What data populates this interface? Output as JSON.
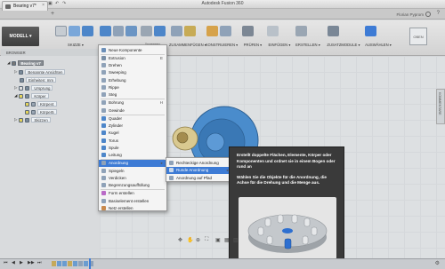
{
  "window": {
    "app_title": "Autodesk Fusion 360",
    "user": "Florian Pyprom"
  },
  "doc_tab": {
    "label": "Bearing v7*"
  },
  "toolbar": {
    "workspace": "MODELL ▾",
    "groups": [
      {
        "label": "SKIZZE ▾",
        "active": false
      },
      {
        "label": "ERSTELLEN ▾",
        "active": true
      },
      {
        "label": "ÄNDERN ▾",
        "active": false
      },
      {
        "label": "ZUSAMMENFÜGEN ▾",
        "active": false
      },
      {
        "label": "KONSTRUIEREN ▾",
        "active": false
      },
      {
        "label": "PRÜFEN ▾",
        "active": false
      },
      {
        "label": "EINFÜGEN ▾",
        "active": false
      },
      {
        "label": "ERSTELLEN ▾",
        "active": false
      },
      {
        "label": "ZUSATZMODULE ▾",
        "active": false
      },
      {
        "label": "AUSWÄHLEN ▾",
        "active": false
      }
    ]
  },
  "browser": {
    "header": "BROWSER",
    "nodes": [
      {
        "label": "Bearing v7",
        "level": 0,
        "sel": true
      },
      {
        "label": "Benannte Ansichten",
        "level": 1
      },
      {
        "label": "Einheiten: mm",
        "level": 1
      },
      {
        "label": "Ursprung",
        "level": 1
      },
      {
        "label": "Körper",
        "level": 1
      },
      {
        "label": "Körper4",
        "level": 2
      },
      {
        "label": "Körper5",
        "level": 2
      },
      {
        "label": "Skizzen",
        "level": 1
      }
    ]
  },
  "menu": {
    "items": [
      {
        "label": "Neue Komponente",
        "shortcut": "",
        "color": "#6c8fb8"
      },
      {
        "label": "Extrusion",
        "shortcut": "E",
        "color": "#7a8fa6"
      },
      {
        "label": "Drehen",
        "shortcut": "",
        "color": "#8fa2b8"
      },
      {
        "label": "Sweeping",
        "shortcut": "",
        "color": "#8fa2b8"
      },
      {
        "label": "Erhebung",
        "shortcut": "",
        "color": "#8fa2b8"
      },
      {
        "label": "Rippe",
        "shortcut": "",
        "color": "#8fa2b8"
      },
      {
        "label": "Steg",
        "shortcut": "",
        "color": "#8fa2b8"
      },
      {
        "label": "Bohrung",
        "shortcut": "H",
        "color": "#8fa2b8"
      },
      {
        "label": "Gewinde",
        "shortcut": "",
        "color": "#8fa2b8"
      },
      {
        "label": "Quader",
        "shortcut": "",
        "color": "#4d86c9"
      },
      {
        "label": "Zylinder",
        "shortcut": "",
        "color": "#4d86c9"
      },
      {
        "label": "Kugel",
        "shortcut": "",
        "color": "#4d86c9"
      },
      {
        "label": "Torus",
        "shortcut": "",
        "color": "#4d86c9"
      },
      {
        "label": "Spule",
        "shortcut": "",
        "color": "#4d86c9"
      },
      {
        "label": "Leitung",
        "shortcut": "",
        "color": "#4d86c9"
      },
      {
        "label": "Anordnung",
        "shortcut": "▸",
        "color": "#8fa2b8",
        "highlight": true
      },
      {
        "label": "Spiegeln",
        "shortcut": "",
        "color": "#8fa2b8"
      },
      {
        "label": "Verdicken",
        "shortcut": "",
        "color": "#8fa2b8"
      },
      {
        "label": "Begrenzungsauffüllung",
        "shortcut": "",
        "color": "#8fa2b8"
      },
      {
        "label": "Form erstellen",
        "shortcut": "",
        "color": "#b96ac7"
      },
      {
        "label": "Basiselement erstellen",
        "shortcut": "",
        "color": "#8fa2b8"
      },
      {
        "label": "Netz erstellen",
        "shortcut": "",
        "color": "#c98a4d"
      }
    ]
  },
  "submenu": {
    "items": [
      {
        "label": "Rechteckige Anordnung",
        "highlight": false
      },
      {
        "label": "Runde Anordnung",
        "highlight": true
      },
      {
        "label": "Anordnung auf Pfad",
        "highlight": false
      }
    ]
  },
  "tooltip": {
    "p1": "Erstellt doppelte Flächen, Elemente, Körper oder Komponenten und ordnet sie in einem Bogen oder rund an",
    "p2": "Wählen Sie die Objekte für die Anordnung, die Achse für die Drehung und die Menge aus."
  },
  "viewcube": {
    "label": "OBEN"
  },
  "right_panel": {
    "label": "KOMMENTARE"
  },
  "colors": {
    "accent": "#3d7bd5",
    "part_blue": "#4a8ccc",
    "part_gold": "#c9b67a"
  }
}
